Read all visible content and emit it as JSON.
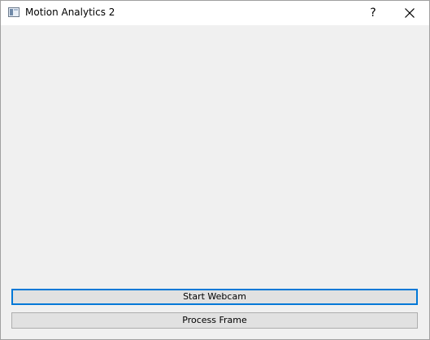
{
  "window": {
    "title": "Motion Analytics 2",
    "help_label": "?",
    "app_icon": "window-app-icon",
    "close_icon": "close-icon"
  },
  "buttons": {
    "start_webcam": "Start Webcam",
    "process_frame": "Process Frame"
  },
  "colors": {
    "window_bg": "#f0f0f0",
    "titlebar_bg": "#ffffff",
    "button_bg": "#e1e1e1",
    "focus_accent": "#0078d7"
  }
}
